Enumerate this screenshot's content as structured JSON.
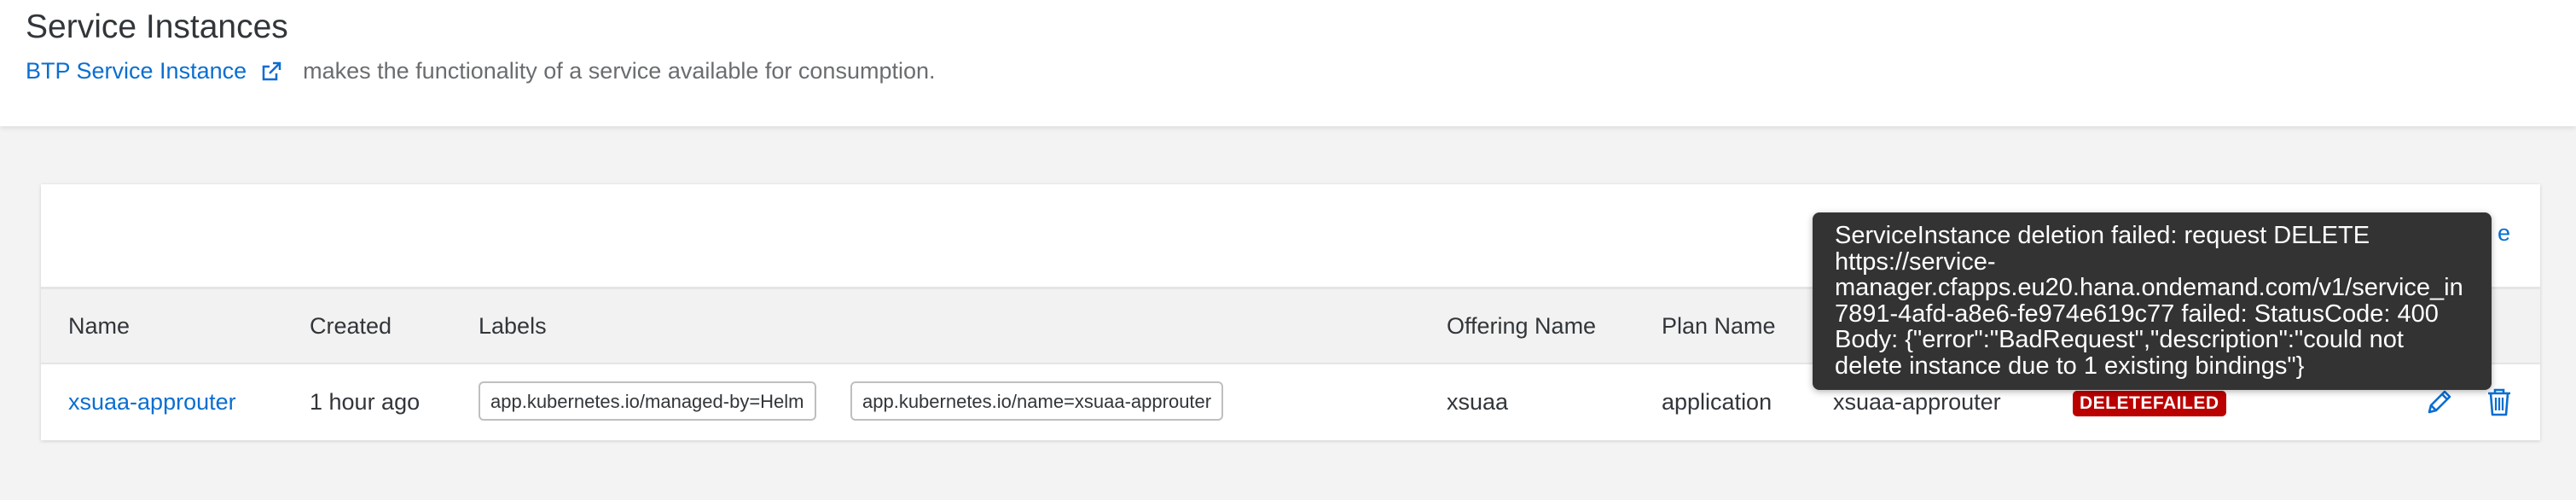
{
  "header": {
    "title": "Service Instances",
    "link_text": "BTP Service Instance",
    "description": "makes the functionality of a service available for consumption."
  },
  "toolbar": {
    "partial_text": "e"
  },
  "table": {
    "columns": [
      "Name",
      "Created",
      "Labels",
      "Offering Name",
      "Plan Name"
    ],
    "rows": [
      {
        "name": "xsuaa-approuter",
        "created": "1 hour ago",
        "labels": [
          "app.kubernetes.io/managed-by=Helm",
          "app.kubernetes.io/name=xsuaa-approuter"
        ],
        "offering_name": "xsuaa",
        "plan_name": "application",
        "external_name": "xsuaa-approuter",
        "status": "DELETEFAILED"
      }
    ]
  },
  "tooltip": {
    "text": "ServiceInstance deletion failed: request DELETE\nhttps://service-\nmanager.cfapps.eu20.hana.ondemand.com/v1/service_in\n7891-4afd-a8e6-fe974e619c77 failed: StatusCode: 400\nBody: {\"error\":\"BadRequest\",\"description\":\"could not\ndelete instance due to 1 existing bindings\"}"
  },
  "colors": {
    "link": "#0a6ed1",
    "error_badge": "#bb0000",
    "tooltip_bg": "#333333"
  },
  "icons": {
    "external_link": "external-link-icon",
    "edit": "pencil-icon",
    "delete": "trash-icon"
  }
}
